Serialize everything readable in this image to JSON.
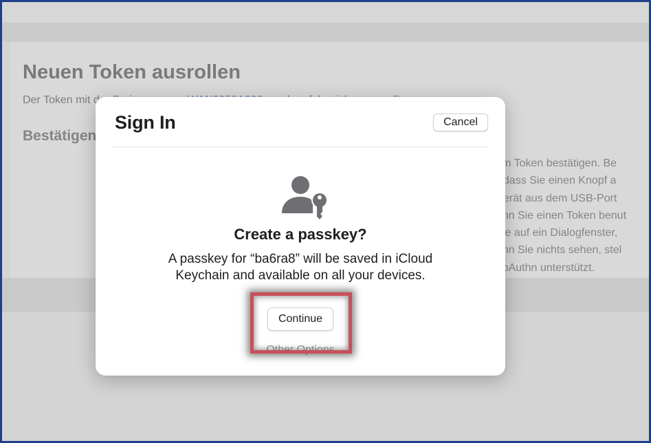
{
  "background": {
    "title": "Neuen Token ausrollen",
    "subtitle_start": "Der Token mit der ",
    "subtitle_link": "Seriennummer WAN0050A030",
    "subtitle_end": " wurde erfolgreich ausgerollt.",
    "heading": "Bestätigen",
    "paragraph_lines": [
      "hrem Token bestätigen. Be",
      "R., dass Sie einen Knopf a",
      "s Gerät aus dem USB-Port",
      "Wenn Sie einen Token benut",
      "n Sie auf ein Dialogfenster,",
      "Wenn Sie nichts sehen, stel",
      "WebAuthn unterstützt."
    ]
  },
  "modal": {
    "title": "Sign In",
    "cancel_label": "Cancel",
    "icon": "person-key-icon",
    "heading": "Create a passkey?",
    "description_line1": "A passkey for “ba6ra8” will be saved in iCloud",
    "description_line2": "Keychain and available on all your devices.",
    "continue_label": "Continue",
    "other_options_label": "Other Options"
  },
  "colors": {
    "highlight": "#c8505a",
    "frame_border": "#1f3f8a",
    "link": "#6f89b0"
  }
}
